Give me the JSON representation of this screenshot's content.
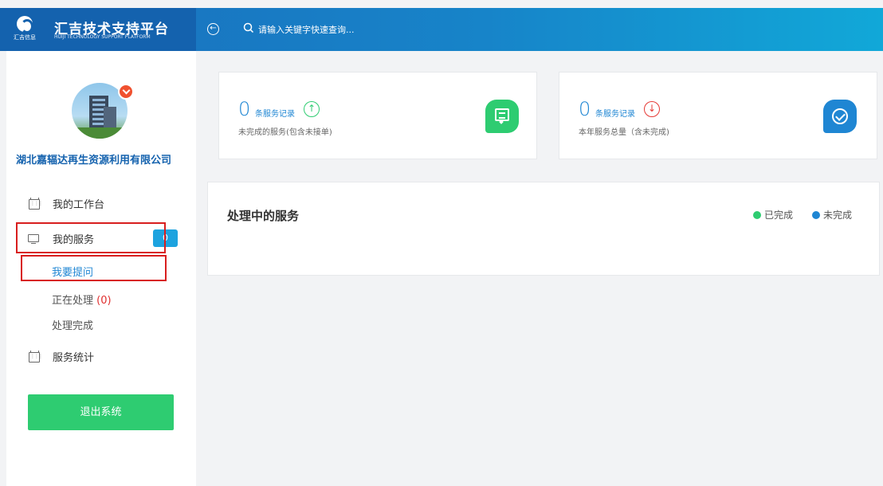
{
  "header": {
    "logo_text": "汇吉信息",
    "title": "汇吉技术支持平台",
    "subtitle": "HUIJI TECHNOLOGY SUPPORT PLATFORM",
    "search_placeholder": "请输入关键字快速查询..."
  },
  "sidebar": {
    "company": "湖北嘉辐达再生资源利用有限公司",
    "nav": {
      "workbench": "我的工作台",
      "my_services": "我的服务",
      "my_services_badge": "0",
      "ask": "我要提问",
      "processing": "正在处理",
      "processing_count": "(0)",
      "completed": "处理完成",
      "stats": "服务统计"
    },
    "logout": "退出系统"
  },
  "cards": [
    {
      "value": "0",
      "unit": "条服务记录",
      "desc": "未完成的服务(包含未接单)",
      "arrow": "up",
      "color": "#2ecc71"
    },
    {
      "value": "0",
      "unit": "条服务记录",
      "desc": "本年服务总量（含未完成)",
      "arrow": "down",
      "color": "#1f86d3"
    }
  ],
  "panel": {
    "title": "处理中的服务",
    "legend_done": "已完成",
    "legend_pending": "未完成",
    "legend_done_color": "#2ecc71",
    "legend_pending_color": "#1f86d3"
  }
}
